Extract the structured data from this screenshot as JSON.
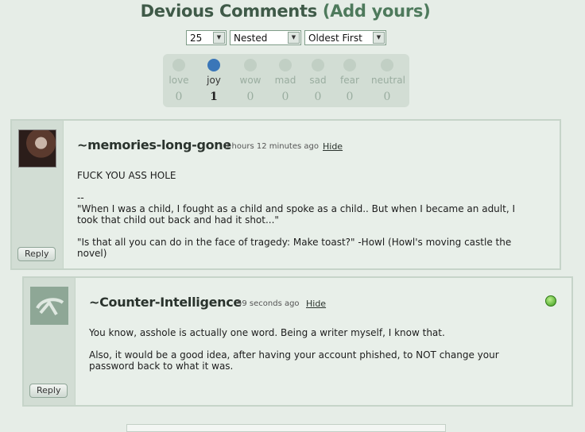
{
  "header": {
    "title": "Devious Comments",
    "add_link": "(Add yours)"
  },
  "controls": {
    "per_page": "25",
    "view_mode": "Nested",
    "sort_order": "Oldest First"
  },
  "moods": [
    {
      "label": "love",
      "count": "0",
      "icon": "love-icon"
    },
    {
      "label": "joy",
      "count": "1",
      "icon": "joy-icon",
      "active": true
    },
    {
      "label": "wow",
      "count": "0",
      "icon": "wow-icon"
    },
    {
      "label": "mad",
      "count": "0",
      "icon": "mad-icon"
    },
    {
      "label": "sad",
      "count": "0",
      "icon": "sad-icon"
    },
    {
      "label": "fear",
      "count": "0",
      "icon": "fear-icon"
    },
    {
      "label": "neutral",
      "count": "0",
      "icon": "neutral-icon"
    }
  ],
  "comments": [
    {
      "author": "~memories-long-gone",
      "time": "3 hours 12 minutes ago",
      "hide": "Hide",
      "text": "FUCK YOU ASS HOLE\n\n--\n\"When I was a child, I fought as a child and spoke as a child.. But when I became an adult, I\ntook that child out back and had it shot...\"\n\n\"Is that all you can do in the face of tragedy: Make toast?\" -Howl (Howl's moving castle the\nnovel)",
      "reply": "Reply"
    },
    {
      "author": "~Counter-Intelligence",
      "time": "59 seconds ago",
      "hide": "Hide",
      "text": "You know, asshole is actually one word. Being a writer myself, I know that.\n\nAlso, it would be a good idea, after having your account phished, to NOT change your\npassword back to what it was.",
      "reply": "Reply"
    }
  ],
  "colors": {
    "background": "#e6ede7",
    "panel": "#d2ddd4",
    "comment_body": "#e8efe9",
    "title": "#3f5a48"
  }
}
